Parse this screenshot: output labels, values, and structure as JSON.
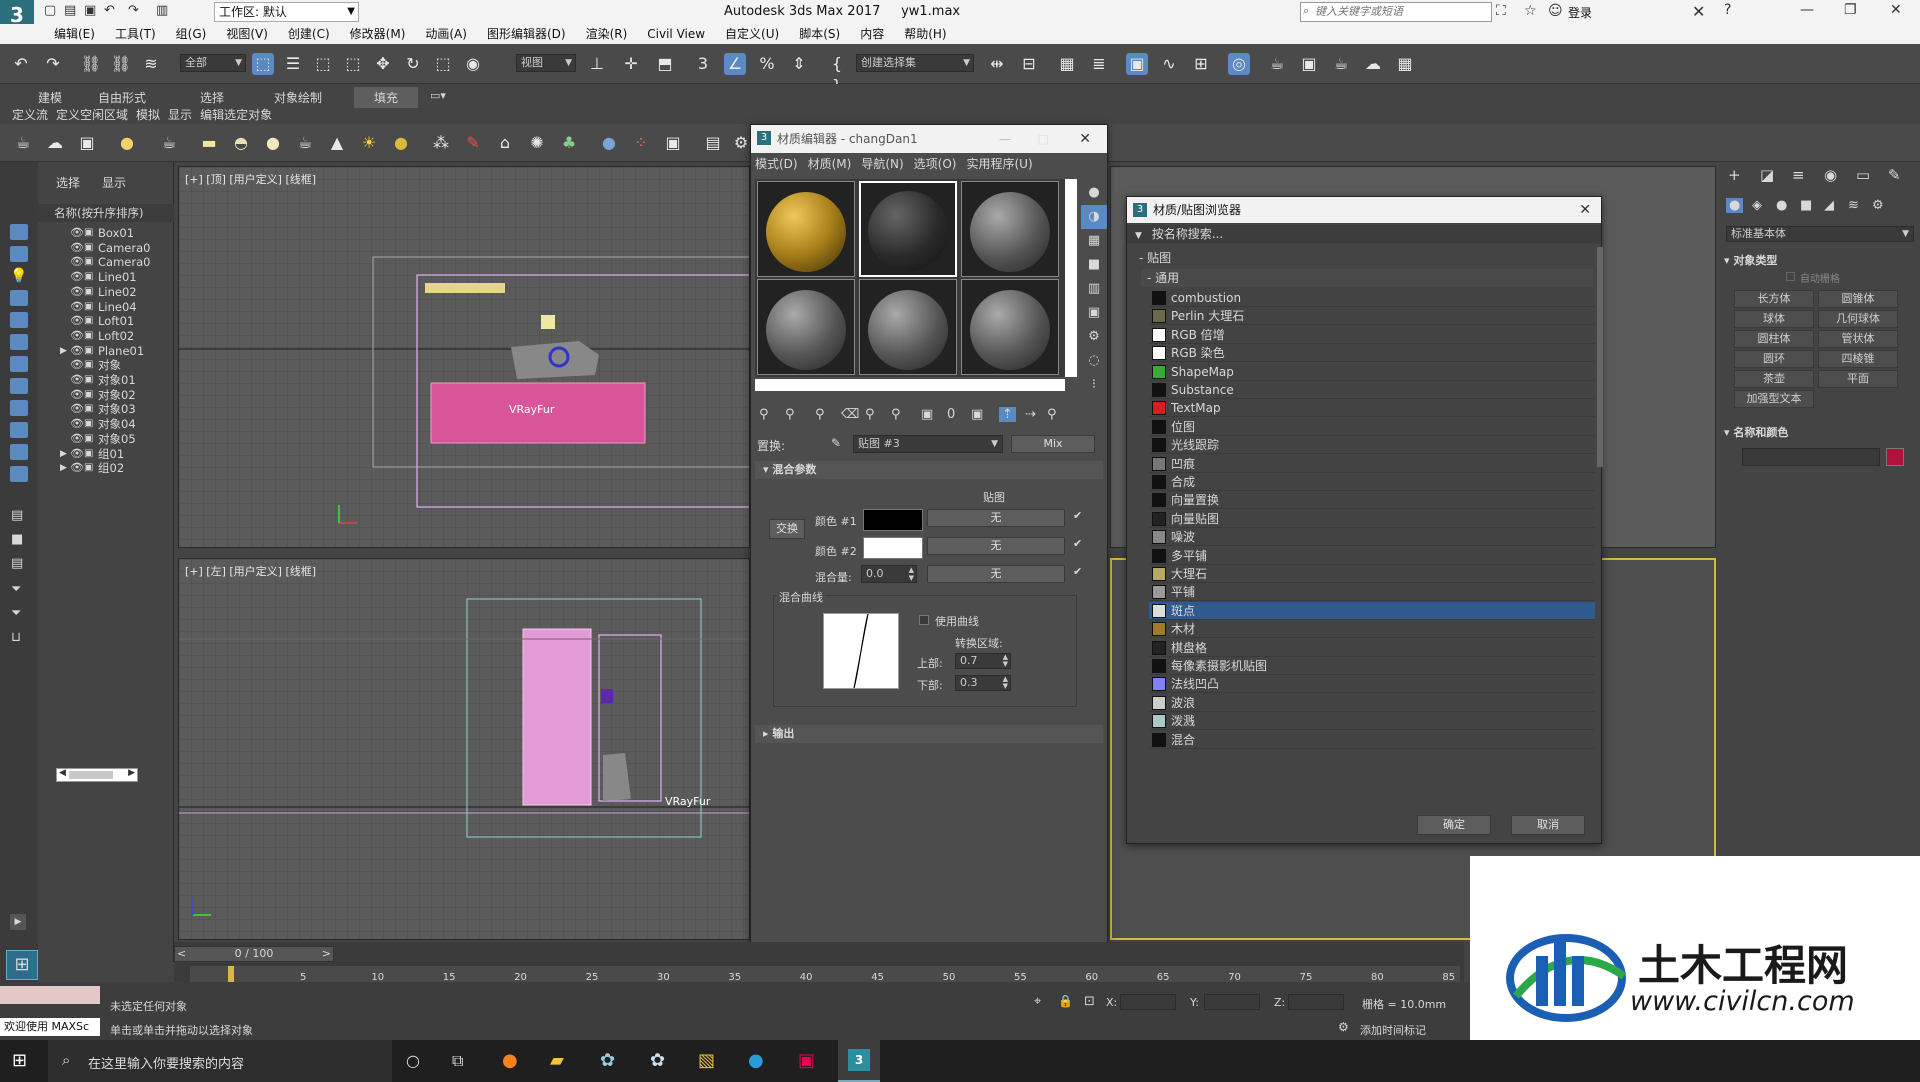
{
  "app": {
    "title": "Autodesk 3ds Max 2017",
    "file": "yw1.max",
    "workspace": "工作区: 默认",
    "search_placeholder": "键入关键字或短语",
    "login": "登录"
  },
  "menu": [
    "编辑(E)",
    "工具(T)",
    "组(G)",
    "视图(V)",
    "创建(C)",
    "修改器(M)",
    "动画(A)",
    "图形编辑器(D)",
    "渲染(R)",
    "Civil View",
    "自定义(U)",
    "脚本(S)",
    "内容",
    "帮助(H)"
  ],
  "toolbar1": {
    "filter": "全部",
    "view": "视图",
    "selection_set": "创建选择集"
  },
  "ribbon": {
    "tabs": [
      "建模",
      "自由形式",
      "选择",
      "对象绘制",
      "填充"
    ],
    "subtabs": [
      "定义流",
      "定义空闲区域",
      "模拟",
      "显示",
      "编辑选定对象"
    ]
  },
  "scene_explorer": {
    "tabs": [
      "选择",
      "显示"
    ],
    "header": "名称(按升序排序)",
    "items": [
      "Box01",
      "Camera0",
      "Camera0",
      "Line01",
      "Line02",
      "Line04",
      "Loft01",
      "Loft02",
      "Plane01",
      "对象",
      "对象01",
      "对象02",
      "对象03",
      "对象04",
      "对象05",
      "组01",
      "组02"
    ]
  },
  "viewports": {
    "top": {
      "label": "[+] [顶] [用户定义] [线框]",
      "object": "VRayFur"
    },
    "left": {
      "label": "[+] [左] [用户定义] [线框]",
      "object": "VRayFur"
    }
  },
  "material_editor": {
    "title": "材质编辑器 - changDan1",
    "menu": [
      "模式(D)",
      "材质(M)",
      "导航(N)",
      "选项(O)",
      "实用程序(U)"
    ],
    "replace_label": "置换:",
    "map_name": "贴图 #3",
    "map_type": "Mix",
    "rollout_mix": "混合参数",
    "map_header": "贴图",
    "swap": "交换",
    "color1_label": "颜色 #1",
    "color2_label": "颜色 #2",
    "mix_amount_label": "混合量:",
    "mix_amount": "0.0",
    "none": "无",
    "mix_curve": "混合曲线",
    "use_curve": "使用曲线",
    "transition_zone": "转换区域:",
    "upper_label": "上部:",
    "upper": "0.7",
    "lower_label": "下部:",
    "lower": "0.3",
    "rollout_output": "输出"
  },
  "mat_browser": {
    "title": "材质/贴图浏览器",
    "search": "按名称搜索...",
    "group": "贴图",
    "subgroup": "通用",
    "items": [
      {
        "name": "combustion",
        "color": "#111111"
      },
      {
        "name": "Perlin 大理石",
        "color": "#6b6a4a"
      },
      {
        "name": "RGB 倍增",
        "color": "#ffffff"
      },
      {
        "name": "RGB 染色",
        "color": "#ffffff"
      },
      {
        "name": "ShapeMap",
        "color": "#3aa83a"
      },
      {
        "name": "Substance",
        "color": "#111111"
      },
      {
        "name": "TextMap",
        "color": "#d42020"
      },
      {
        "name": "位图",
        "color": "#111111"
      },
      {
        "name": "光线跟踪",
        "color": "#111111"
      },
      {
        "name": "凹痕",
        "color": "#777777"
      },
      {
        "name": "合成",
        "color": "#111111"
      },
      {
        "name": "向量置换",
        "color": "#111111"
      },
      {
        "name": "向量贴图",
        "color": "#222222"
      },
      {
        "name": "噪波",
        "color": "#888888"
      },
      {
        "name": "多平铺",
        "color": "#111111"
      },
      {
        "name": "大理石",
        "color": "#b8a868"
      },
      {
        "name": "平铺",
        "color": "#999999"
      },
      {
        "name": "斑点",
        "color": "#dddddd"
      },
      {
        "name": "木材",
        "color": "#a07a2a"
      },
      {
        "name": "棋盘格",
        "color": "#222222"
      },
      {
        "name": "每像素摄影机贴图",
        "color": "#111111"
      },
      {
        "name": "法线凹凸",
        "color": "#8080ff"
      },
      {
        "name": "波浪",
        "color": "#cccccc"
      },
      {
        "name": "泼溅",
        "color": "#aac8c8"
      },
      {
        "name": "混合",
        "color": "#111111"
      }
    ],
    "selected": "斑点",
    "ok": "确定",
    "cancel": "取消"
  },
  "command_panel": {
    "category": "标准基本体",
    "object_type": "对象类型",
    "autogrid": "自动栅格",
    "buttons": [
      "长方体",
      "圆锥体",
      "球体",
      "几何球体",
      "圆柱体",
      "管状体",
      "圆环",
      "四棱锥",
      "茶壶",
      "平面",
      "加强型文本"
    ],
    "name_color": "名称和颜色"
  },
  "timeline": {
    "frame": "0 / 100",
    "ticks": [
      "5",
      "10",
      "15",
      "20",
      "25",
      "30",
      "35",
      "40",
      "45",
      "50",
      "55",
      "60",
      "65",
      "70",
      "75",
      "80",
      "85"
    ]
  },
  "status": {
    "maxscript": "欢迎使用 MAXSc",
    "line1": "未选定任何对象",
    "line2": "单击或单击并拖动以选择对象",
    "x": "X:",
    "y": "Y:",
    "z": "Z:",
    "grid": "栅格 = 10.0mm",
    "add_time_tag": "添加时间标记"
  },
  "taskbar": {
    "search": "在这里输入你要搜索的内容"
  },
  "watermark": {
    "cn": "土木工程网",
    "url": "www.civilcn.com"
  }
}
